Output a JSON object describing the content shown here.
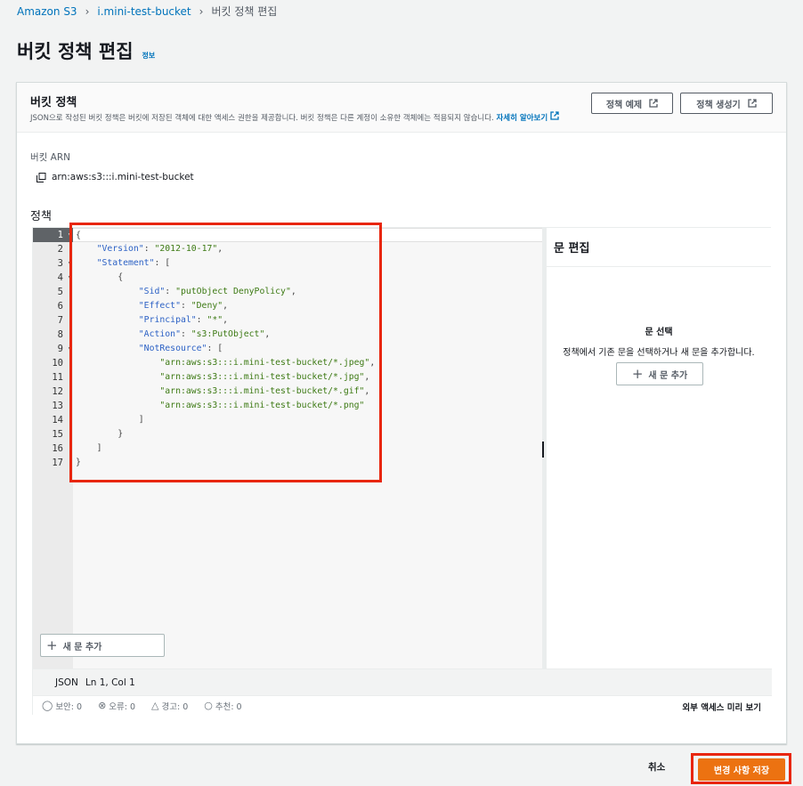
{
  "breadcrumb": {
    "items": [
      "Amazon S3",
      "i.mini-test-bucket"
    ],
    "current": "버킷 정책 편집"
  },
  "page": {
    "title": "버킷 정책 편집",
    "info": "정보"
  },
  "panel": {
    "title": "버킷 정책",
    "description": "JSON으로 작성된 버킷 정책은 버킷에 저장된 객체에 대한 액세스 권한을 제공합니다. 버킷 정책은 다른 계정이 소유한 객체에는 적용되지 않습니다.",
    "learn_more": "자세히 알아보기",
    "policy_examples": "정책 예제",
    "policy_generator": "정책 생성기"
  },
  "arn": {
    "label": "버킷 ARN",
    "value": "arn:aws:s3:::i.mini-test-bucket"
  },
  "policy_label": "정책",
  "editor": {
    "line_numbers": [
      "1",
      "2",
      "3",
      "4",
      "5",
      "6",
      "7",
      "8",
      "9",
      "10",
      "11",
      "12",
      "13",
      "14",
      "15",
      "16",
      "17"
    ],
    "lines": {
      "l1": "{",
      "l2k": "\"Version\"",
      "l2v": "\"2012-10-17\"",
      "l3k": "\"Statement\"",
      "l3b": "[",
      "l4": "{",
      "l5k": "\"Sid\"",
      "l5v": "\"putObject DenyPolicy\"",
      "l6k": "\"Effect\"",
      "l6v": "\"Deny\"",
      "l7k": "\"Principal\"",
      "l7v": "\"*\"",
      "l8k": "\"Action\"",
      "l8v": "\"s3:PutObject\"",
      "l9k": "\"NotResource\"",
      "l9b": "[",
      "l10": "\"arn:aws:s3:::i.mini-test-bucket/*.jpeg\"",
      "l11": "\"arn:aws:s3:::i.mini-test-bucket/*.jpg\"",
      "l12": "\"arn:aws:s3:::i.mini-test-bucket/*.gif\"",
      "l13": "\"arn:aws:s3:::i.mini-test-bucket/*.png\"",
      "l14": "]",
      "l15": "}",
      "l16": "]",
      "l17": "}"
    },
    "add_statement": "새 문 추가"
  },
  "side_panel": {
    "title": "문 편집",
    "empty_title": "문 선택",
    "empty_desc": "정책에서 기존 문을 선택하거나 새 문을 추가합니다.",
    "add_statement": "새 문 추가"
  },
  "status": {
    "language": "JSON",
    "position": "Ln 1, Col 1"
  },
  "validation": {
    "security": "보안: 0",
    "errors": "오류: 0",
    "warnings": "경고: 0",
    "suggestions": "추천: 0",
    "preview": "외부 액세스 미리 보기"
  },
  "footer": {
    "cancel": "취소",
    "save": "변경 사항 저장"
  },
  "colors": {
    "primary": "#ec7211",
    "link": "#0073bb",
    "highlight": "#e8260d"
  }
}
